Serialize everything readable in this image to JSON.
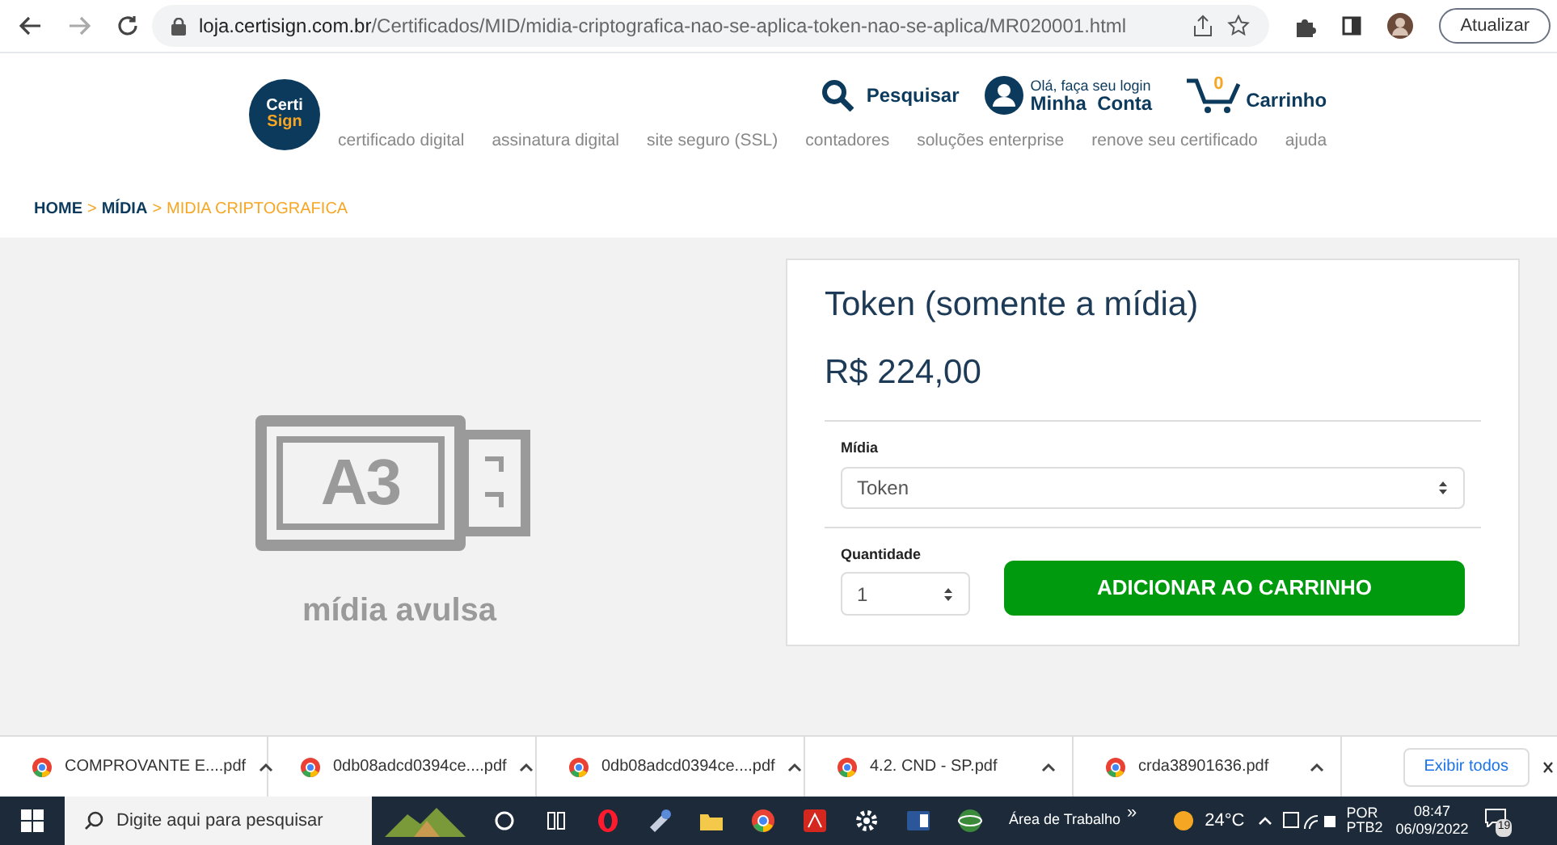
{
  "browser": {
    "url_host": "loja.certisign.com.br",
    "url_path": "/Certificados/MID/midia-criptografica-nao-se-aplica-token-nao-se-aplica/MR020001.html",
    "update_button": "Atualizar"
  },
  "header": {
    "logo": [
      "Certi",
      "Sign"
    ],
    "search": "Pesquisar",
    "account_hint": "Olá, faça seu login",
    "account": "Minha  Conta",
    "cart_count": "0",
    "cart": "Carrinho",
    "nav": [
      "certificado digital",
      "assinatura digital",
      "site seguro (SSL)",
      "contadores",
      "soluções enterprise",
      "renove seu certificado",
      "ajuda"
    ]
  },
  "breadcrumb_separator": ">",
  "breadcrumb": [
    {
      "label": "HOME",
      "current": false
    },
    {
      "label": "MÍDIA",
      "current": false
    },
    {
      "label": "MIDIA CRIPTOGRAFICA",
      "current": true
    }
  ],
  "product": {
    "image_label": "A3",
    "image_caption": "mídia avulsa",
    "title": "Token (somente a mídia)",
    "price": "R$ 224,00",
    "media_label": "Mídia",
    "media_value": "Token",
    "quantity_label": "Quantidade",
    "quantity_value": "1",
    "add_button": "ADICIONAR AO CARRINHO"
  },
  "downloads": {
    "items": [
      "COMPROVANTE E....pdf",
      "0db08adcd0394ce....pdf",
      "0db08adcd0394ce....pdf",
      "4.2. CND - SP.pdf",
      "crda38901636.pdf"
    ],
    "show_all": "Exibir todos"
  },
  "taskbar": {
    "search_placeholder": "Digite aqui para pesquisar",
    "desktop": "Área de Trabalho",
    "chevrons": "»",
    "temperature": "24°C",
    "lang": "POR",
    "layout": "PTB2",
    "time": "08:47",
    "date": "06/09/2022",
    "notif_count": "19"
  }
}
